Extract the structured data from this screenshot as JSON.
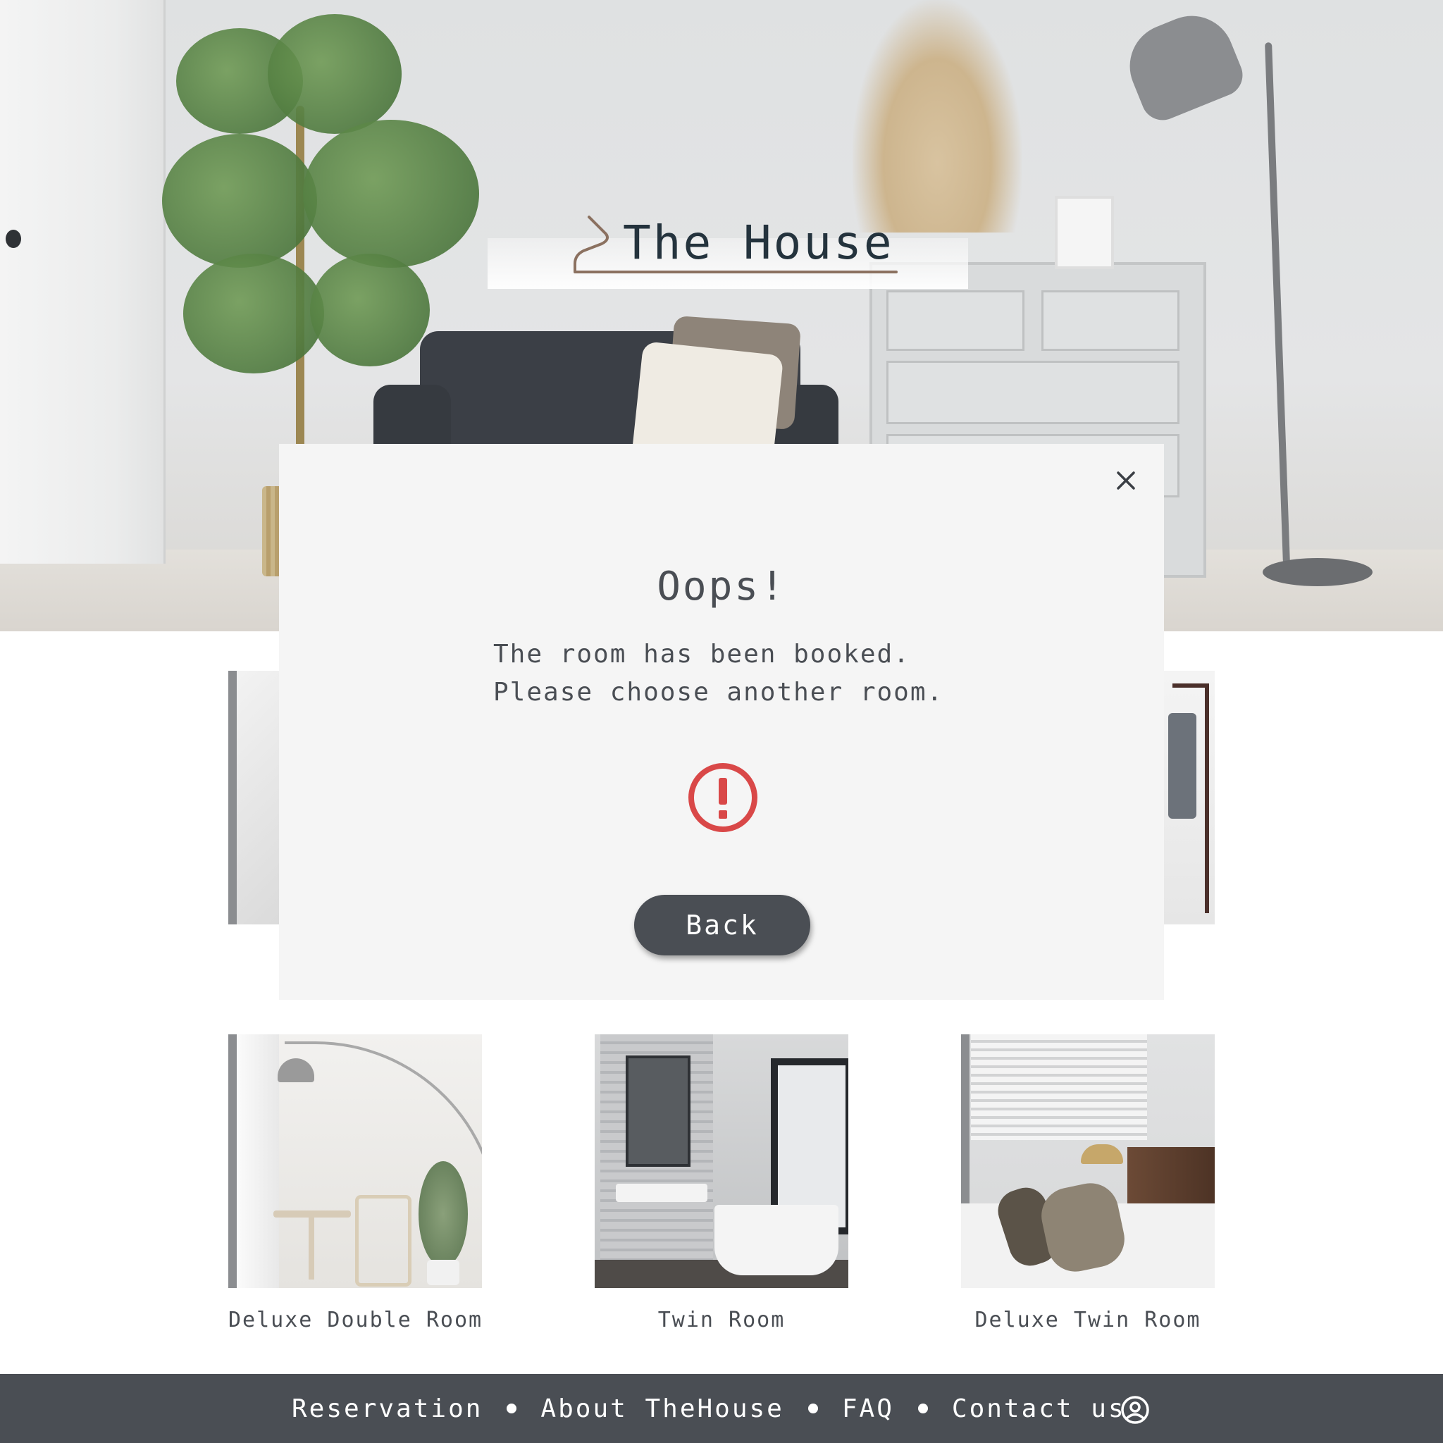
{
  "brand": {
    "name": "The House"
  },
  "rooms": [
    {
      "name": ""
    },
    {
      "name": ""
    },
    {
      "name": "Deluxe Double Room"
    },
    {
      "name": "Twin Room"
    },
    {
      "name": "Deluxe Twin Room"
    }
  ],
  "modal": {
    "title": "Oops!",
    "message_line1": "The room has been booked.",
    "message_line2": "Please choose another room.",
    "back_label": "Back",
    "alert_icon": "alert-circle-icon",
    "close_icon": "close-icon"
  },
  "footer": {
    "links": [
      "Reservation",
      "About TheHouse",
      "FAQ",
      "Contact us"
    ],
    "account_icon": "user-circle-icon"
  },
  "colors": {
    "dark": "#4a4e54",
    "modal_bg": "#f5f5f5",
    "alert": "#d94848",
    "logo_text": "#24333d"
  }
}
